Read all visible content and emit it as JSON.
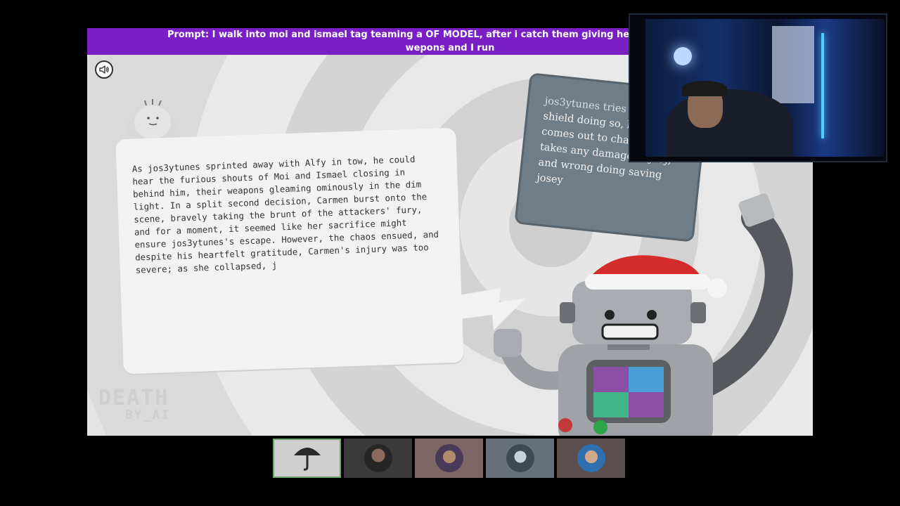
{
  "game": {
    "prompt": "Prompt: I walk into moi and ismael tag teaming a OF MODEL, after i catch them giving her the tacata i snap c",
    "prompt_line2": "wepons and I run",
    "story_text": "As jos3ytunes sprinted away with Alfy in tow, he could hear the furious shouts of Moi and Ismael closing in behind him, their weapons gleaming ominously in the dim light. In a split second decision, Carmen burst onto the scene, bravely taking the brunt of the attackers' fury, and for a moment, it seemed like her sacrifice might ensure jos3ytunes's escape. However, the chaos ensued, and despite his heartfelt gratitude, Carmen's injury was too severe; as she collapsed, j",
    "speech_first": "jos3ytunes tries",
    "speech_rest": "my human shield doing so, his girl comes out to chare him and takes any damage, injury, and wrong doing saving josey",
    "logo_line1": "DEATH",
    "logo_line2": "BY_AI"
  },
  "icons": {
    "sound": "speaker-icon"
  },
  "colors": {
    "banner": "#7a1fc4",
    "selected_thumb_border": "#6fa86f"
  },
  "players": [
    {
      "name": "player-1",
      "selected": true,
      "bg": "#cfcfcf"
    },
    {
      "name": "player-2",
      "selected": false,
      "bg": "#3a3a3a"
    },
    {
      "name": "player-3",
      "selected": false,
      "bg": "#7d6666"
    },
    {
      "name": "player-4",
      "selected": false,
      "bg": "#66707a"
    },
    {
      "name": "player-5",
      "selected": false,
      "bg": "#5c4e4e"
    }
  ]
}
